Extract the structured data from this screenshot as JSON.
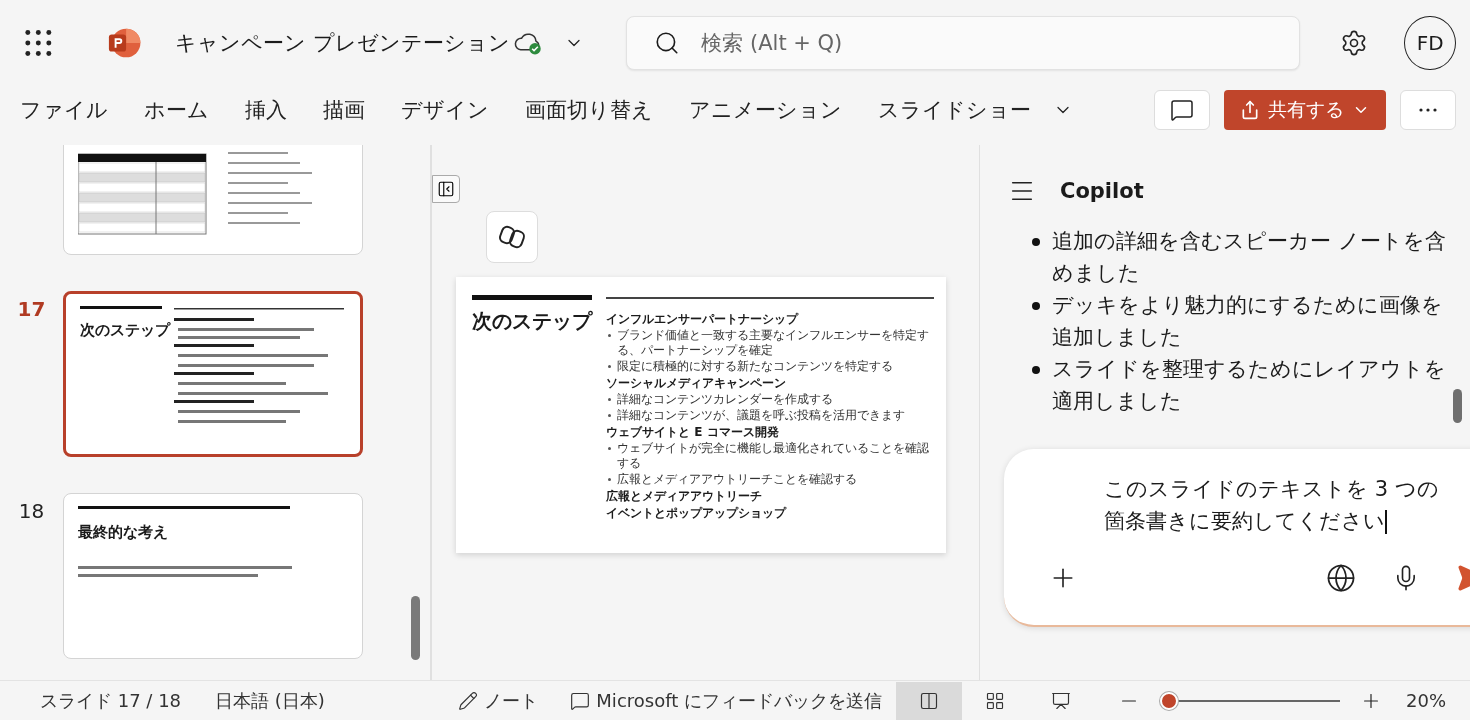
{
  "app": {
    "title": "キャンペーン プレゼンテーション",
    "search": {
      "placeholder": "検索 (Alt + Q)"
    },
    "avatar": "FD"
  },
  "ribbon": {
    "tabs": [
      {
        "label": "ファイル"
      },
      {
        "label": "ホーム"
      },
      {
        "label": "挿入"
      },
      {
        "label": "描画"
      },
      {
        "label": "デザイン"
      },
      {
        "label": "画面切り替え"
      },
      {
        "label": "アニメーション"
      },
      {
        "label": "スライドショー"
      }
    ],
    "share": "共有する"
  },
  "thumbnails": [
    {
      "kind": "table",
      "selected": false
    },
    {
      "kind": "bullets",
      "number": "17",
      "title": "次のステップ",
      "selected": true
    },
    {
      "kind": "text",
      "number": "18",
      "title": "最終的な考え",
      "selected": false
    }
  ],
  "slide": {
    "title": "次のステップ",
    "sections": [
      {
        "heading": "インフルエンサーパートナーシップ",
        "bullets": [
          "ブランド価値と一致する主要なインフルエンサーを特定する、パートナーシップを確定",
          "限定に積極的に対する新たなコンテンツを特定する"
        ]
      },
      {
        "heading": "ソーシャルメディアキャンペーン",
        "bullets": [
          "詳細なコンテンツカレンダーを作成する",
          "詳細なコンテンツが、議題を呼ぶ投稿を活用できます"
        ]
      },
      {
        "heading": "ウェブサイトと E コマース開発",
        "bullets": [
          "ウェブサイトが完全に機能し最適化されていることを確認する",
          "広報とメディアアウトリーチことを確認する"
        ]
      },
      {
        "heading": "広報とメディアアウトリーチ"
      },
      {
        "heading": "イベントとポップアップショップ"
      }
    ]
  },
  "copilot": {
    "title": "Copilot",
    "bullets": [
      "追加の詳細を含むスピーカー ノートを含めました",
      "デッキをより魅力的にするために画像を追加しました",
      "スライドを整理するためにレイアウトを適用しました"
    ],
    "input": "このスライドのテキストを 3 つの箇条書きに要約してください"
  },
  "status_bar": {
    "slide": "スライド 17 / 18",
    "language": "日本語 (日本)",
    "notes": "ノート",
    "feedback": "Microsoft にフィードバックを送信",
    "views": [
      {
        "kind": "normal",
        "selected": true
      },
      {
        "kind": "sorter",
        "selected": false
      },
      {
        "kind": "presenter",
        "selected": false
      }
    ],
    "zoom": {
      "level": 0.05,
      "reading": "20%"
    }
  }
}
